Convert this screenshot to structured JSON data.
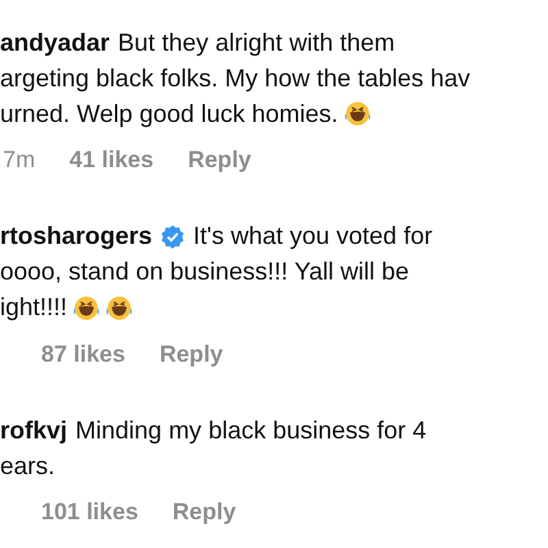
{
  "comments": [
    {
      "username": "andyadar",
      "verified": false,
      "lines": [
        [
          {
            "kind": "text",
            "text": "But they alright with them"
          }
        ],
        [
          {
            "kind": "text",
            "text": "argeting black folks. My how the tables hav"
          }
        ],
        [
          {
            "kind": "text",
            "text": "urned. Welp good luck homies."
          },
          {
            "kind": "emoji"
          }
        ]
      ],
      "time": "7m",
      "likes": "41 likes",
      "reply": "Reply"
    },
    {
      "username": "rtosharogers",
      "verified": true,
      "lines": [
        [
          {
            "kind": "text",
            "text": "It's what you voted for"
          }
        ],
        [
          {
            "kind": "text",
            "text": "oooo, stand on business!!! Yall will be"
          }
        ],
        [
          {
            "kind": "text",
            "text": "ight!!!!"
          },
          {
            "kind": "emoji"
          },
          {
            "kind": "emoji"
          }
        ]
      ],
      "likes": "87 likes",
      "reply": "Reply"
    },
    {
      "username": "rofkvj",
      "verified": false,
      "lines": [
        [
          {
            "kind": "text",
            "text": "Minding my black business for 4"
          }
        ],
        [
          {
            "kind": "text",
            "text": "ears."
          }
        ]
      ],
      "likes": "101 likes",
      "reply": "Reply"
    }
  ]
}
